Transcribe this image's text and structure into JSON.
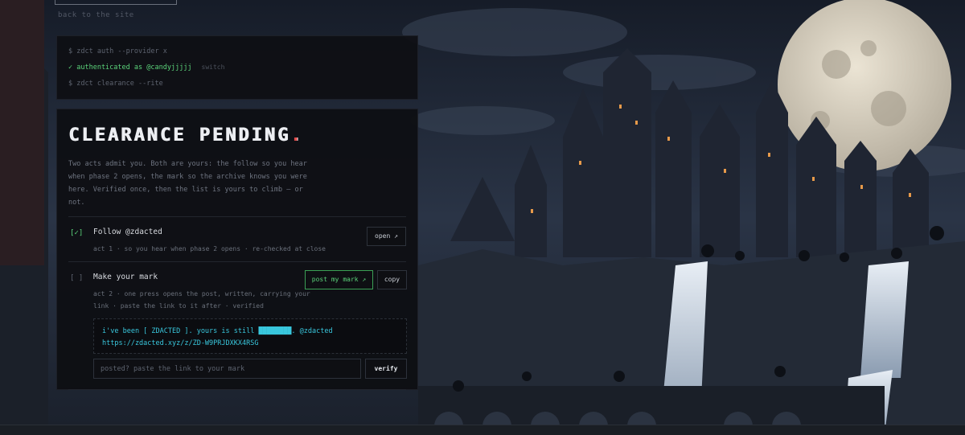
{
  "colors": {
    "panel_bg": "#0e0f13",
    "success_green": "#5bd37a",
    "accent_red": "#e04b4b",
    "mark_cyan": "#39c7dd",
    "moon": "#d9d2c2",
    "sky": "#1c2433"
  },
  "nav": {
    "back_label": "back to the site"
  },
  "terminal": {
    "auth_cmd": "$ zdct auth --provider x",
    "auth_status": "✓ authenticated as @candyjjjjj",
    "switch_label": "switch",
    "clearance_cmd": "$ zdct clearance --rite"
  },
  "card": {
    "title": "CLEARANCE PENDING",
    "title_dot": ".",
    "intro": "Two acts admit you. Both are yours: the follow so you hear when phase 2 opens, the mark so the archive knows you were here. Verified once, then the list is yours to climb — or not.",
    "tasks": [
      {
        "check": "[✓]",
        "done": true,
        "title": "Follow @zdacted",
        "subtitle": "act 1 · so you hear when phase 2 opens · re-checked at close",
        "open_label": "open ↗"
      },
      {
        "check": "[ ]",
        "done": false,
        "title": "Make your mark",
        "subtitle": "act 2 · one press opens the post, written, carrying your link · paste the link to it after · verified",
        "post_label": "post my mark ↗",
        "copy_label": "copy",
        "mark_line1": "i've been [ ZDACTED ]. yours is still ████████. @zdacted",
        "mark_line2": "https://zdacted.xyz/z/ZD-W9PRJDXKX4RSG",
        "input_placeholder": "posted? paste the link to your mark",
        "verify_label": "verify"
      }
    ]
  }
}
